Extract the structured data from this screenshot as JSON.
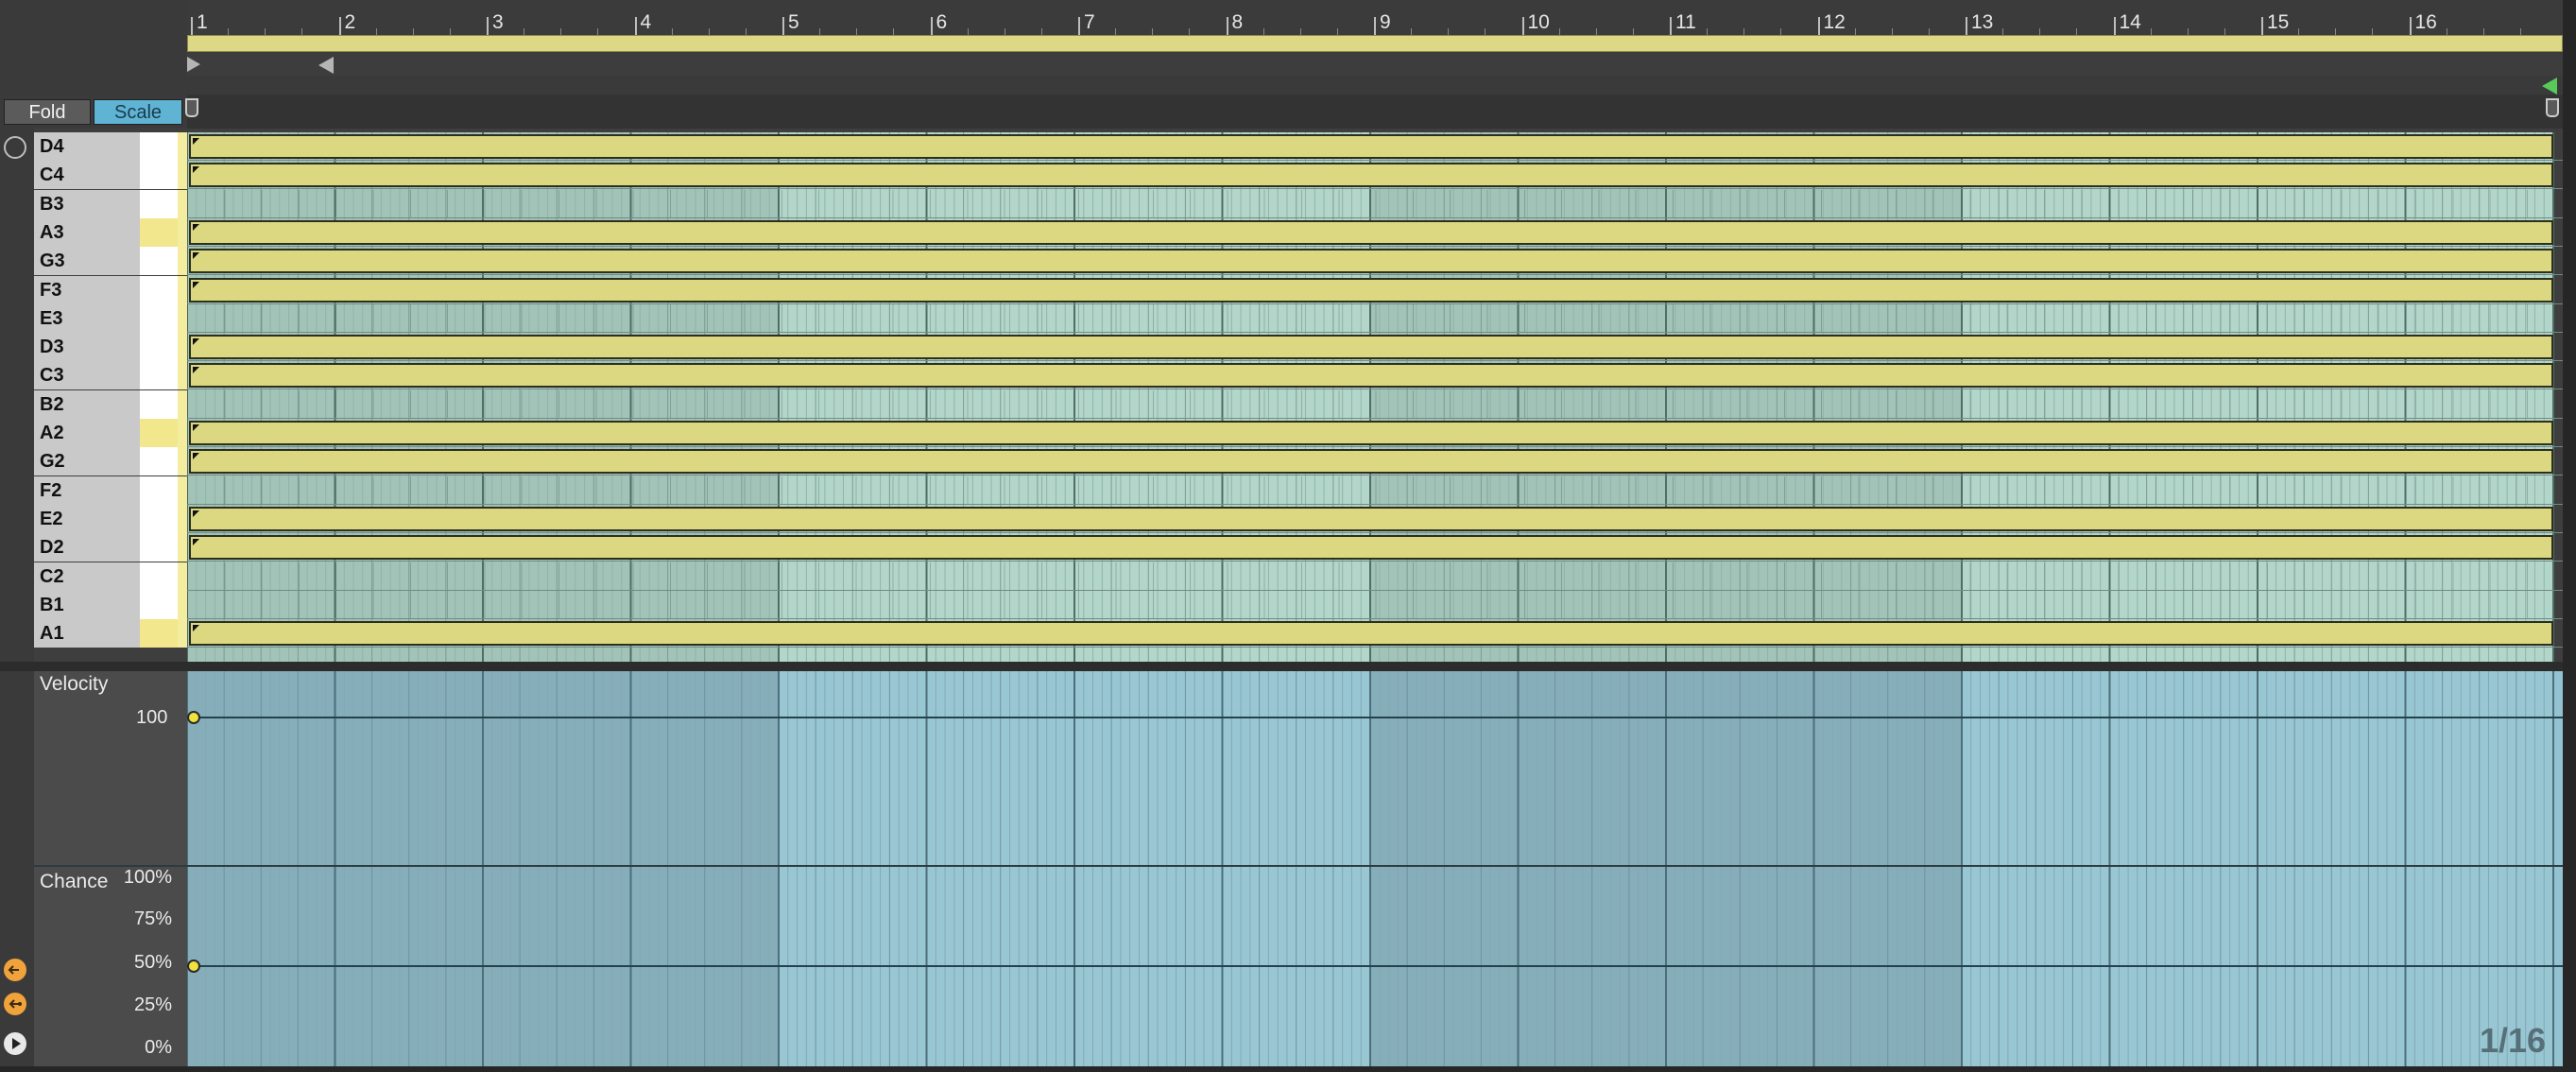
{
  "buttons": {
    "fold": "Fold",
    "scale": "Scale"
  },
  "ruler": {
    "bars": [
      "1",
      "2",
      "3",
      "4",
      "5",
      "6",
      "7",
      "8",
      "9",
      "10",
      "11",
      "12",
      "13",
      "14",
      "15",
      "16"
    ]
  },
  "keys": [
    {
      "label": "D4",
      "in_scale": true,
      "has_note": true,
      "root": false
    },
    {
      "label": "C4",
      "in_scale": true,
      "has_note": true,
      "root": false
    },
    {
      "label": "B3",
      "in_scale": false,
      "has_note": false,
      "root": false
    },
    {
      "label": "A3",
      "in_scale": true,
      "has_note": true,
      "root": true
    },
    {
      "label": "G3",
      "in_scale": true,
      "has_note": true,
      "root": false
    },
    {
      "label": "F3",
      "in_scale": true,
      "has_note": true,
      "root": false
    },
    {
      "label": "E3",
      "in_scale": false,
      "has_note": false,
      "root": false
    },
    {
      "label": "D3",
      "in_scale": true,
      "has_note": true,
      "root": false
    },
    {
      "label": "C3",
      "in_scale": true,
      "has_note": true,
      "root": false
    },
    {
      "label": "B2",
      "in_scale": false,
      "has_note": false,
      "root": false
    },
    {
      "label": "A2",
      "in_scale": true,
      "has_note": true,
      "root": true
    },
    {
      "label": "G2",
      "in_scale": true,
      "has_note": true,
      "root": false
    },
    {
      "label": "F2",
      "in_scale": false,
      "has_note": false,
      "root": false
    },
    {
      "label": "E2",
      "in_scale": true,
      "has_note": true,
      "root": false
    },
    {
      "label": "D2",
      "in_scale": true,
      "has_note": true,
      "root": false
    },
    {
      "label": "C2",
      "in_scale": false,
      "has_note": false,
      "root": false
    },
    {
      "label": "B1",
      "in_scale": false,
      "has_note": false,
      "root": false
    },
    {
      "label": "A1",
      "in_scale": true,
      "has_note": true,
      "root": true
    }
  ],
  "velocity": {
    "title": "Velocity",
    "value_label": "100"
  },
  "chance": {
    "title": "Chance",
    "ticks": [
      "100%",
      "75%",
      "50%",
      "25%",
      "0%"
    ],
    "value_percent": 50
  },
  "zoom": "1/16",
  "colors": {
    "note_fill": "#dcd882",
    "scale_button": "#5fb3d3",
    "lane_bg": "#93c3d0",
    "preview_icon": "#f0a23b",
    "end_marker": "#59c95a"
  }
}
